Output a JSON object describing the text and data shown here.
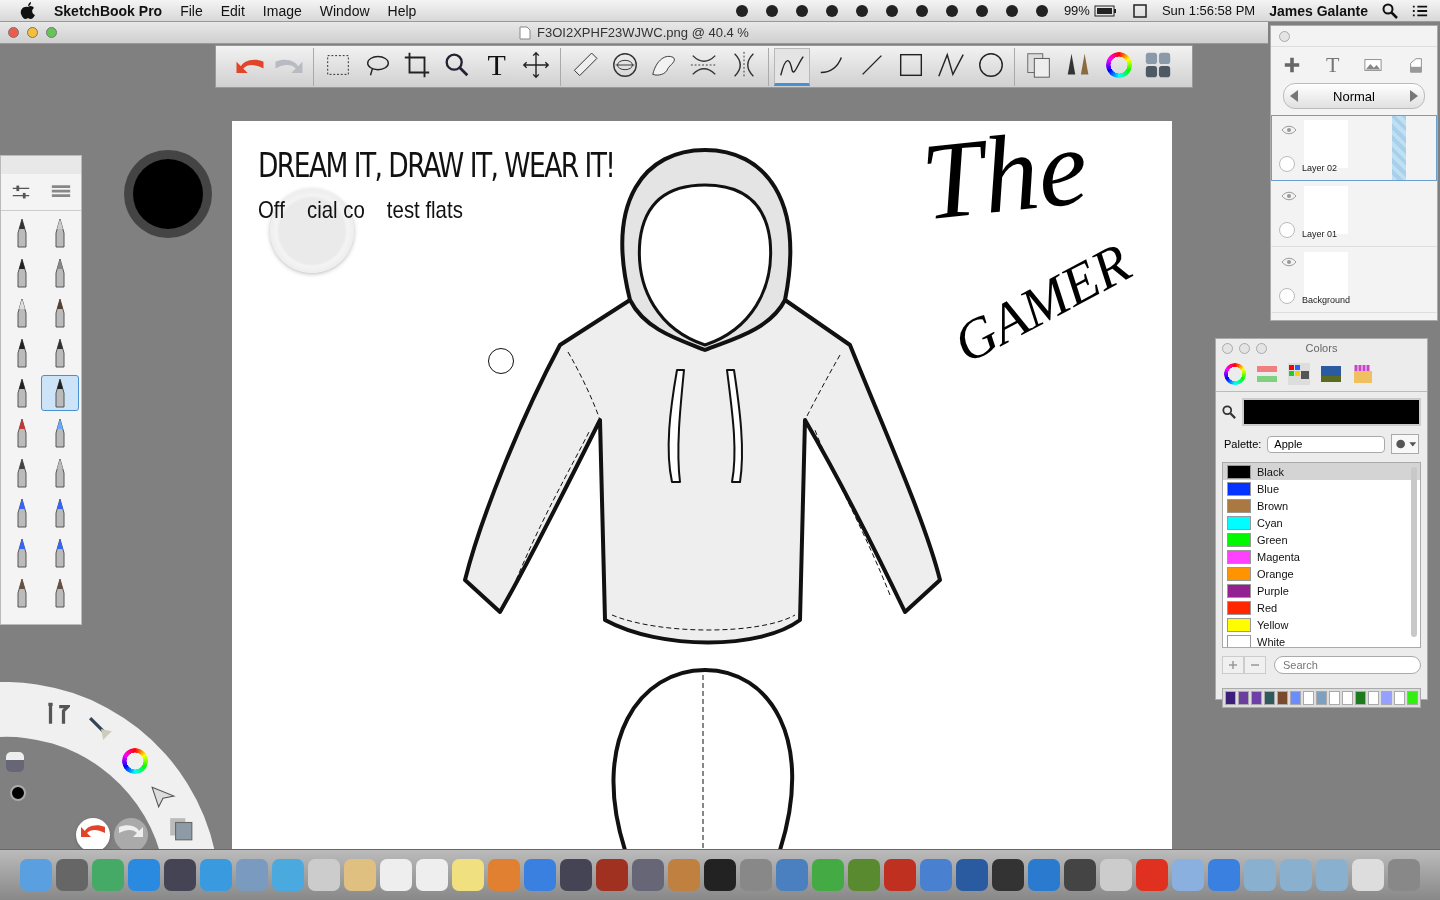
{
  "menubar": {
    "app_name": "SketchBook Pro",
    "menus": [
      "File",
      "Edit",
      "Image",
      "Window",
      "Help"
    ],
    "battery": "99%",
    "clock": "Sun 1:56:58 PM",
    "user": "James Galante"
  },
  "document_title": "F3OI2XPHF23WJWC.png @ 40.4 %",
  "toolbar": {
    "groups": [
      [
        {
          "kind": "undo",
          "selected": false
        },
        {
          "kind": "redo",
          "selected": false
        }
      ],
      [
        {
          "kind": "select-rect",
          "selected": false
        },
        {
          "kind": "lasso",
          "selected": false
        },
        {
          "kind": "crop",
          "selected": false
        },
        {
          "kind": "zoom",
          "selected": false
        },
        {
          "kind": "text",
          "label": "T",
          "selected": false
        },
        {
          "kind": "move",
          "selected": false
        }
      ],
      [
        {
          "kind": "ruler",
          "selected": false
        },
        {
          "kind": "ellipse-guide",
          "selected": false
        },
        {
          "kind": "french-curve",
          "selected": false
        },
        {
          "kind": "symmetry-x",
          "selected": false
        },
        {
          "kind": "symmetry-y",
          "selected": false
        }
      ],
      [
        {
          "kind": "freehand",
          "selected": true
        },
        {
          "kind": "curve",
          "selected": false
        },
        {
          "kind": "line",
          "selected": false
        },
        {
          "kind": "rect",
          "selected": false
        },
        {
          "kind": "polyline",
          "selected": false
        },
        {
          "kind": "ellipse",
          "selected": false
        }
      ],
      [
        {
          "kind": "copy",
          "selected": false
        },
        {
          "kind": "brushes",
          "selected": false
        },
        {
          "kind": "color-wheel",
          "selected": false
        },
        {
          "kind": "palettes",
          "selected": false
        }
      ]
    ]
  },
  "canvas": {
    "headline": "DREAM IT, DRAW IT, WEAR IT!",
    "subheading_parts": [
      "Off",
      "cial co",
      "test flats"
    ],
    "signature": [
      "The",
      "GAMER"
    ]
  },
  "layers_panel": {
    "text_button": "T",
    "blend_mode": "Normal",
    "layers": [
      {
        "name": "Layer 02",
        "selected": true
      },
      {
        "name": "Layer 01",
        "selected": false
      },
      {
        "name": "Background",
        "selected": false
      }
    ]
  },
  "colors_panel": {
    "title": "Colors",
    "palette_label": "Palette:",
    "palette": "Apple",
    "colors": [
      {
        "name": "Black",
        "color": "#000000",
        "selected": true
      },
      {
        "name": "Blue",
        "color": "#0433ff",
        "selected": false
      },
      {
        "name": "Brown",
        "color": "#aa7942",
        "selected": false
      },
      {
        "name": "Cyan",
        "color": "#00fdff",
        "selected": false
      },
      {
        "name": "Green",
        "color": "#00f900",
        "selected": false
      },
      {
        "name": "Magenta",
        "color": "#ff40ff",
        "selected": false
      },
      {
        "name": "Orange",
        "color": "#ff9300",
        "selected": false
      },
      {
        "name": "Purple",
        "color": "#942192",
        "selected": false
      },
      {
        "name": "Red",
        "color": "#ff2600",
        "selected": false
      },
      {
        "name": "Yellow",
        "color": "#fffb00",
        "selected": false
      },
      {
        "name": "White",
        "color": "#ffffff",
        "selected": false
      }
    ],
    "search_placeholder": "Search",
    "swatches": [
      {
        "color": "#3b1f7a"
      },
      {
        "color": "#6b3fa0"
      },
      {
        "color": "#6f3fa8"
      },
      {
        "color": "#2f5a5c"
      },
      {
        "color": "#7a4a2e"
      },
      {
        "color": "#6a8cff"
      },
      {
        "color": "#ffffff"
      },
      {
        "color": "#7da0c0"
      },
      {
        "color": "#ffffff"
      },
      {
        "color": "#ffffff"
      },
      {
        "color": "#1e7a1e"
      },
      {
        "color": "#ffffff"
      },
      {
        "color": "#96a0ff"
      },
      {
        "color": "#ffffff"
      },
      {
        "color": "#33ee11"
      }
    ]
  },
  "brush_palette": {
    "brushes": [
      {
        "selected": false
      },
      {
        "selected": false
      },
      {
        "selected": false
      },
      {
        "selected": false
      },
      {
        "selected": false
      },
      {
        "selected": false
      },
      {
        "selected": false
      },
      {
        "selected": false
      },
      {
        "selected": false
      },
      {
        "selected": true
      },
      {
        "selected": false
      },
      {
        "selected": false
      },
      {
        "selected": false
      },
      {
        "selected": false
      },
      {
        "selected": false
      },
      {
        "selected": false
      },
      {
        "selected": false
      },
      {
        "selected": false
      },
      {
        "selected": false
      },
      {
        "selected": false
      }
    ]
  }
}
